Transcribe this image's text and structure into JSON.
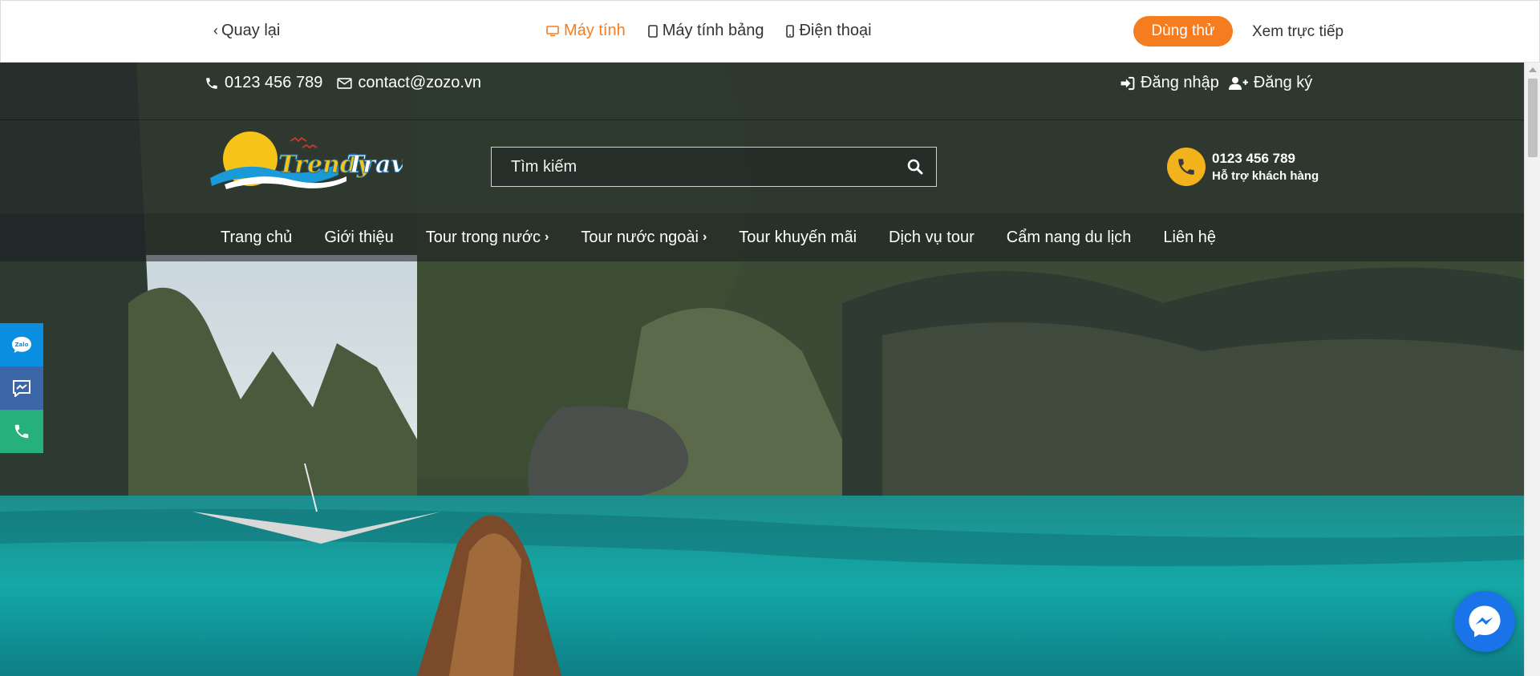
{
  "preview_bar": {
    "back_label": "Quay lại",
    "devices": [
      {
        "label": "Máy tính",
        "icon": "desktop-icon",
        "active": true
      },
      {
        "label": "Máy tính bảng",
        "icon": "tablet-icon",
        "active": false
      },
      {
        "label": "Điện thoại",
        "icon": "phone-icon",
        "active": false
      }
    ],
    "try_label": "Dùng thử",
    "live_label": "Xem trực tiếp",
    "accent_color": "#f57c1f"
  },
  "site": {
    "topbar": {
      "phone": "0123 456 789",
      "email": "contact@zozo.vn",
      "login_label": "Đăng nhập",
      "register_label": "Đăng ký"
    },
    "search": {
      "placeholder": "Tìm kiếm"
    },
    "hotline": {
      "number": "0123 456 789",
      "subtitle": "Hỗ trợ khách hàng"
    },
    "nav": [
      {
        "label": "Trang chủ",
        "has_submenu": false
      },
      {
        "label": "Giới thiệu",
        "has_submenu": false
      },
      {
        "label": "Tour trong nước",
        "has_submenu": true
      },
      {
        "label": "Tour nước ngoài",
        "has_submenu": true
      },
      {
        "label": "Tour khuyến mãi",
        "has_submenu": false
      },
      {
        "label": "Dịch vụ tour",
        "has_submenu": false
      },
      {
        "label": "Cẩm nang du lịch",
        "has_submenu": false
      },
      {
        "label": "Liên hệ",
        "has_submenu": false
      }
    ],
    "float_buttons": [
      {
        "name": "zalo",
        "label": "Zalo",
        "color": "#0a8fe0"
      },
      {
        "name": "messenger",
        "color": "#3b67a8"
      },
      {
        "name": "call",
        "color": "#26b07a"
      }
    ],
    "messenger_bubble_color": "#1a73e8"
  }
}
